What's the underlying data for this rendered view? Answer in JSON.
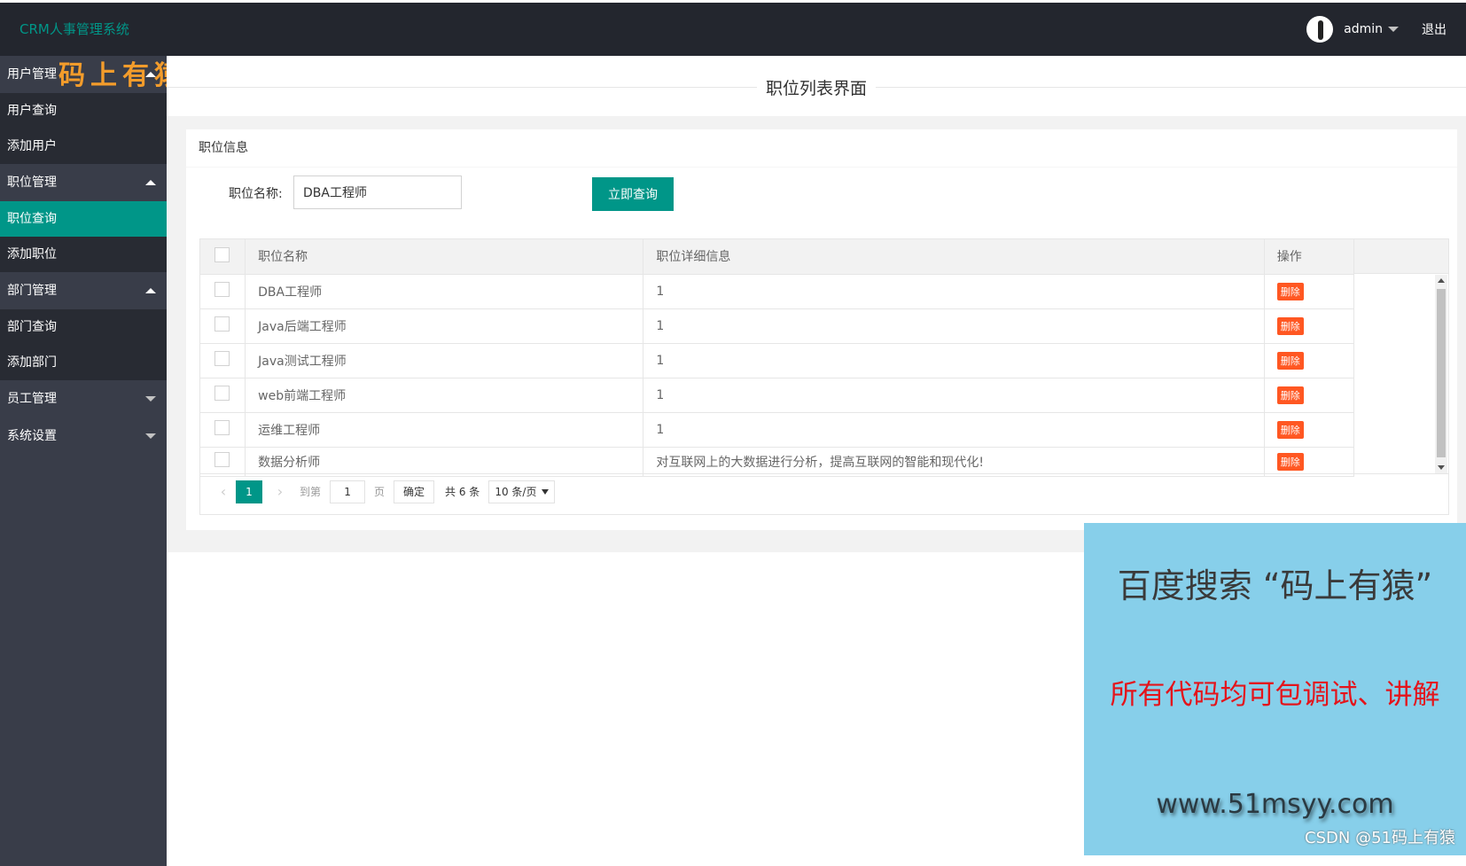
{
  "header": {
    "logo": "CRM人事管理系统",
    "user": "admin",
    "logout": "退出"
  },
  "watermark": "码上有猿",
  "sidebar": {
    "groups": [
      {
        "label": "用户管理",
        "children": [
          "用户查询",
          "添加用户"
        ]
      },
      {
        "label": "职位管理",
        "children": [
          "职位查询",
          "添加职位"
        ]
      },
      {
        "label": "部门管理",
        "children": [
          "部门查询",
          "添加部门"
        ]
      },
      {
        "label": "员工管理"
      },
      {
        "label": "系统设置"
      }
    ]
  },
  "page": {
    "title": "职位列表界面",
    "card_title": "职位信息",
    "search_label": "职位名称:",
    "search_value": "DBA工程师",
    "search_button": "立即查询"
  },
  "table": {
    "headers": [
      "职位名称",
      "职位详细信息",
      "操作"
    ],
    "rows": [
      {
        "name": "DBA工程师",
        "detail": "1",
        "action": "删除"
      },
      {
        "name": "Java后端工程师",
        "detail": "1",
        "action": "删除"
      },
      {
        "name": "Java测试工程师",
        "detail": "1",
        "action": "删除"
      },
      {
        "name": "web前端工程师",
        "detail": "1",
        "action": "删除"
      },
      {
        "name": "运维工程师",
        "detail": "1",
        "action": "删除"
      },
      {
        "name": "数据分析师",
        "detail": "对互联网上的大数据进行分析，提高互联网的智能和现代化!",
        "action": "删除"
      }
    ]
  },
  "pager": {
    "current": "1",
    "goto_label": "到第",
    "goto_value": "1",
    "page_unit": "页",
    "ok": "确定",
    "total": "共 6 条",
    "size": "10 条/页"
  },
  "promo": {
    "line1": "百度搜索 “码上有猿”",
    "line2": "所有代码均可包调试、讲解",
    "line3": "www.51msyy.com",
    "credit": "CSDN @51码上有猿"
  },
  "colors": {
    "accent": "#009688",
    "danger": "#ff5722",
    "sidebar": "#393d49",
    "header": "#23262e"
  }
}
